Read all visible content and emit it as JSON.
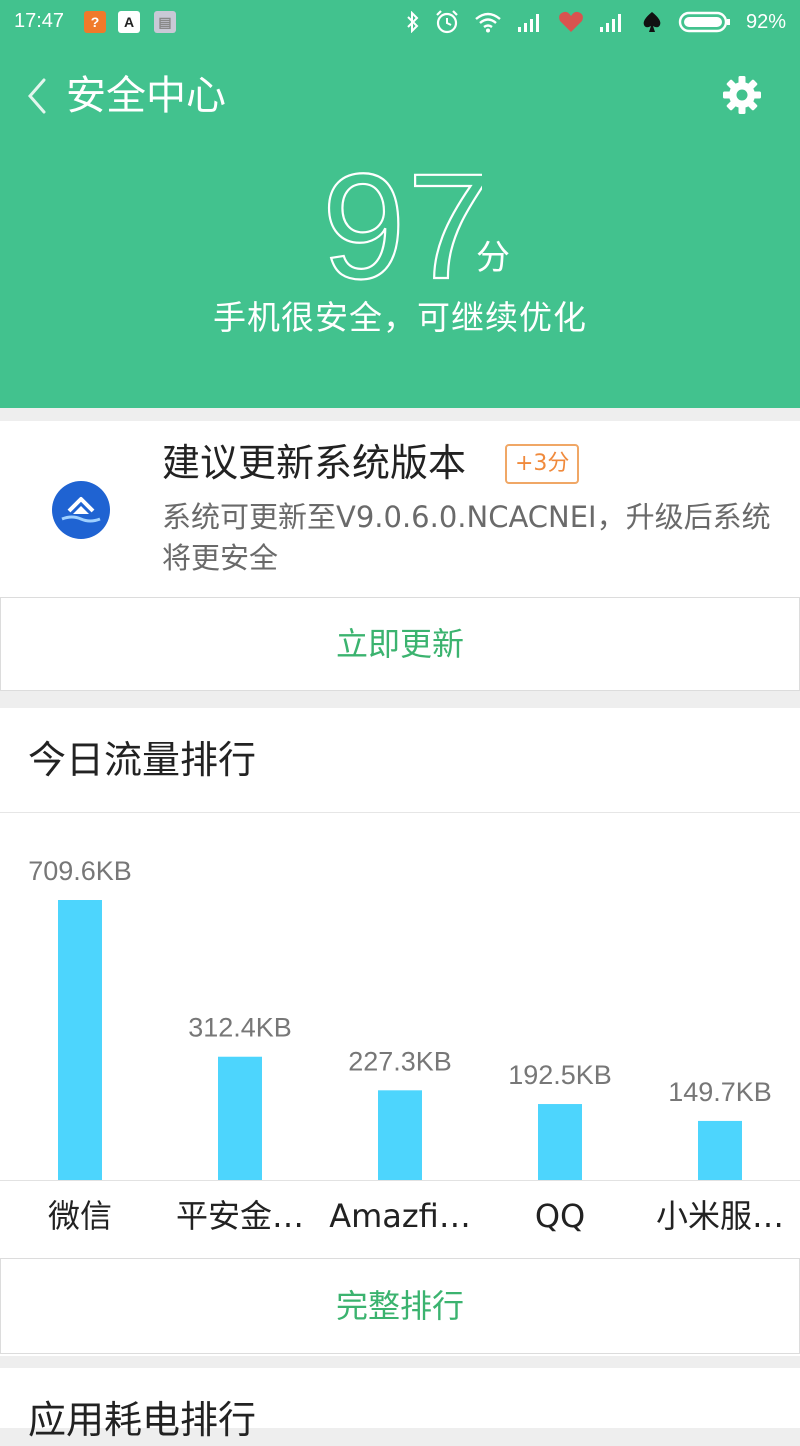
{
  "status_bar": {
    "time": "17:47",
    "battery_percent": "92%",
    "icons": [
      "notification-app-icon",
      "notification-a-icon",
      "notification-square-icon",
      "bluetooth-icon",
      "alarm-icon",
      "wifi-icon",
      "signal-icon",
      "heart-icon",
      "signal-icon",
      "spade-icon",
      "battery-icon"
    ]
  },
  "nav": {
    "title": "安全中心",
    "back_icon": "chevron-left-icon",
    "settings_icon": "gear-icon"
  },
  "score": {
    "value": "97",
    "unit": "分",
    "description": "手机很安全，可继续优化"
  },
  "update_card": {
    "icon": "system-update-icon",
    "title": "建议更新系统版本",
    "badge": "+3分",
    "description": "系统可更新至V9.0.6.0.NCACNEI，升级后系统将更安全",
    "button_label": "立即更新"
  },
  "traffic": {
    "title": "今日流量排行",
    "button_label": "完整排行"
  },
  "chart_data": {
    "type": "bar",
    "categories": [
      "微信",
      "平安金…",
      "Amazfi…",
      "QQ",
      "小米服…"
    ],
    "values": [
      709.6,
      312.4,
      227.3,
      192.5,
      149.7
    ],
    "value_labels": [
      "709.6KB",
      "312.4KB",
      "227.3KB",
      "192.5KB",
      "149.7KB"
    ],
    "unit": "KB",
    "title": "",
    "xlabel": "",
    "ylabel": "",
    "ylim": [
      0,
      709.6
    ],
    "grid": false,
    "bar_color": "#4dd5fd"
  },
  "power": {
    "title": "应用耗电排行"
  },
  "colors": {
    "header_green": "#42c28e",
    "action_green": "#3bb36f",
    "badge_orange": "#f08a3c",
    "bar_blue": "#4dd5fd"
  }
}
